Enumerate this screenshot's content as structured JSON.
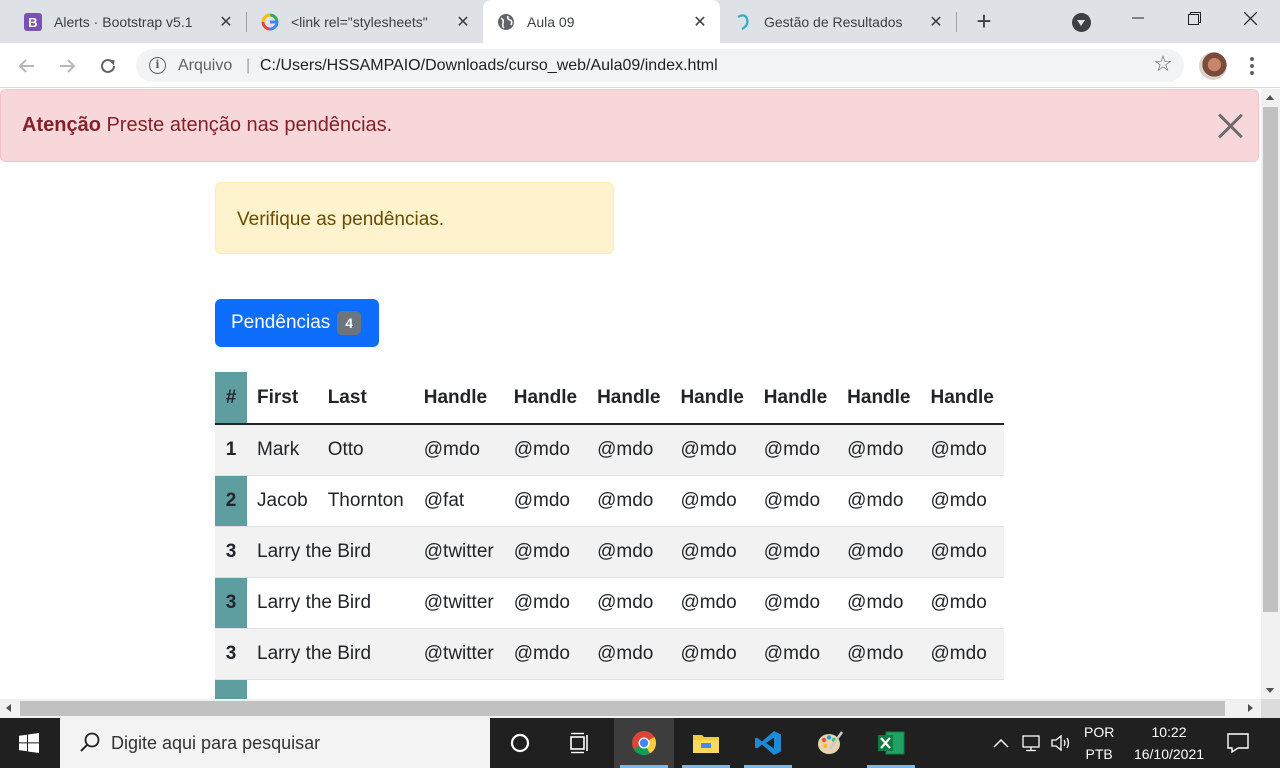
{
  "browser": {
    "tabs": [
      {
        "title": "Alerts · Bootstrap v5.1",
        "favicon": "bootstrap-icon"
      },
      {
        "title": "<link rel=\"stylesheets\"",
        "favicon": "google-icon"
      },
      {
        "title": "Aula 09",
        "favicon": "globe-icon",
        "active": true
      },
      {
        "title": "Gestão de Resultados",
        "favicon": "brand-icon"
      }
    ],
    "address": {
      "scheme": "Arquivo",
      "separator": "|",
      "url": "C:/Users/HSSAMPAIO/Downloads/curso_web/Aula09/index.html"
    }
  },
  "page": {
    "alert_danger": {
      "strong": "Atenção",
      "text": "Preste atenção nas pendências."
    },
    "alert_warning": {
      "text": "Verifique as pendências."
    },
    "button": {
      "label": "Pendências",
      "badge": "4"
    },
    "table": {
      "headers": [
        "#",
        "First",
        "Last",
        "Handle",
        "Handle",
        "Handle",
        "Handle",
        "Handle",
        "Handle",
        "Handle"
      ],
      "rows": [
        [
          "1",
          "Mark",
          "Otto",
          "@mdo",
          "@mdo",
          "@mdo",
          "@mdo",
          "@mdo",
          "@mdo",
          "@mdo"
        ],
        [
          "2",
          "Jacob",
          "Thornton",
          "@fat",
          "@mdo",
          "@mdo",
          "@mdo",
          "@mdo",
          "@mdo",
          "@mdo"
        ],
        [
          "3",
          "Larry the Bird",
          "",
          "@twitter",
          "@mdo",
          "@mdo",
          "@mdo",
          "@mdo",
          "@mdo",
          "@mdo"
        ],
        [
          "3",
          "Larry the Bird",
          "",
          "@twitter",
          "@mdo",
          "@mdo",
          "@mdo",
          "@mdo",
          "@mdo",
          "@mdo"
        ],
        [
          "3",
          "Larry the Bird",
          "",
          "@twitter",
          "@mdo",
          "@mdo",
          "@mdo",
          "@mdo",
          "@mdo",
          "@mdo"
        ]
      ]
    }
  },
  "taskbar": {
    "search_placeholder": "Digite aqui para pesquisar",
    "language": "POR",
    "layout": "PTB",
    "time": "10:22",
    "date": "16/10/2021",
    "apps": [
      "cortana-icon",
      "task-view-icon",
      "chrome-icon",
      "file-explorer-icon",
      "vscode-icon",
      "paint-icon",
      "excel-icon"
    ]
  },
  "colors": {
    "danger_bg": "#f8d7da",
    "warning_bg": "#fff3cd",
    "primary": "#0d6efd",
    "index_col": "#5f9ea0"
  }
}
